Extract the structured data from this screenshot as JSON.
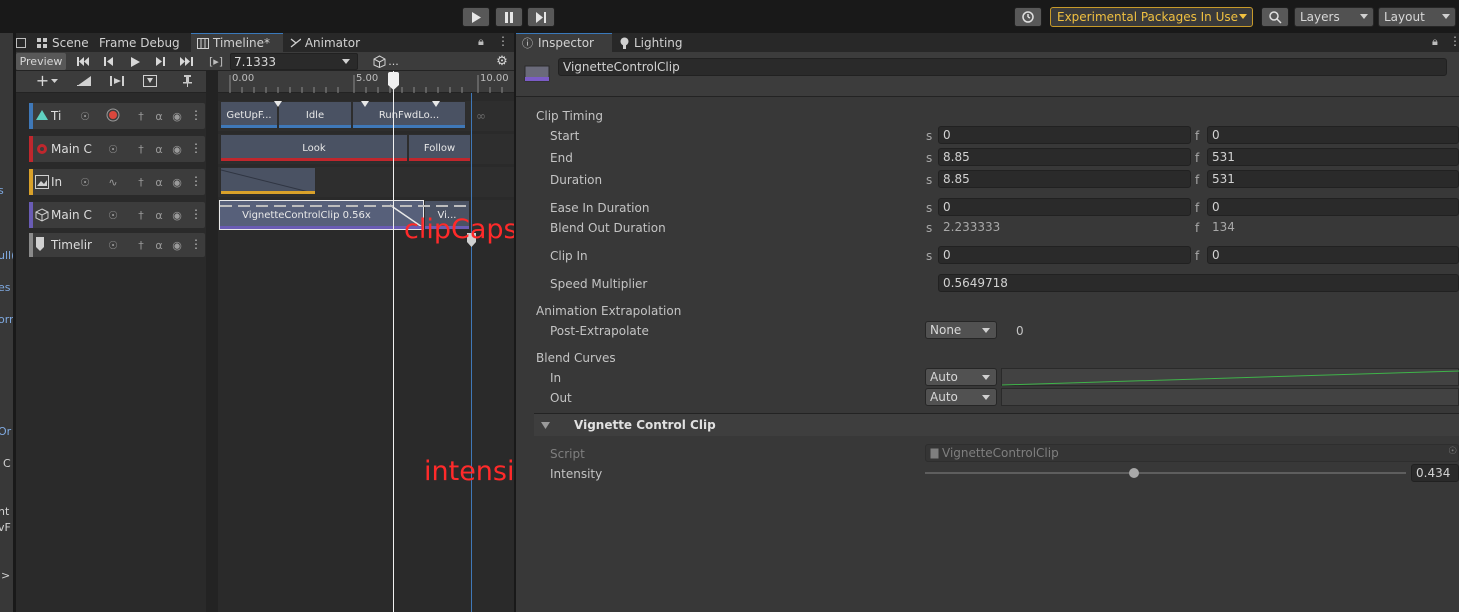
{
  "toolbar": {
    "experimental_label": "Experimental Packages In Use",
    "layers_label": "Layers",
    "layout_label": "Layout"
  },
  "left_sliver": [
    "s",
    "ull(",
    "es",
    "orr",
    "Or",
    "C",
    "nt",
    "vF",
    ">"
  ],
  "timeline_tabs": [
    {
      "label": "Scene"
    },
    {
      "label": "Frame Debug"
    },
    {
      "label": "Timeline*"
    },
    {
      "label": "Animator"
    }
  ],
  "timeline_controls": {
    "preview_label": "Preview",
    "time_value": "7.1333",
    "frame_bracket": "[▸]",
    "asset_dots": "..."
  },
  "ruler": {
    "ticks": [
      "0.00",
      "5.00",
      "10.00"
    ],
    "playhead_seconds": 7.1333
  },
  "tracks": [
    {
      "name": "Ti",
      "stripe": "#3f78b8",
      "icon": "activation-icon"
    },
    {
      "name": "Main C",
      "stripe": "#c0272d",
      "icon": "animator-icon"
    },
    {
      "name": "In",
      "stripe": "#d9a12a",
      "icon": "image-icon"
    },
    {
      "name": "Main C",
      "stripe": "#6a5cb5",
      "icon": "cube-icon"
    },
    {
      "name": "Timelir",
      "stripe": "#8a8a8a",
      "icon": "timeline-icon"
    }
  ],
  "clips": {
    "track1": [
      "GetUpF...",
      "Idle",
      "RunFwdLo..."
    ],
    "track2": [
      "Look",
      "Follow"
    ],
    "track4": [
      "VignetteControlClip 0.56x",
      "Vi..."
    ]
  },
  "inspector_tabs": [
    {
      "label": "Inspector"
    },
    {
      "label": "Lighting"
    }
  ],
  "inspector": {
    "object_name": "VignetteControlClip",
    "clip_timing_header": "Clip Timing",
    "rows": [
      {
        "label": "Start",
        "s": "0",
        "f": "0"
      },
      {
        "label": "End",
        "s": "8.85",
        "f": "531"
      },
      {
        "label": "Duration",
        "s": "8.85",
        "f": "531"
      },
      {
        "label": "Ease In Duration",
        "s": "0",
        "f": "0"
      },
      {
        "label": "Blend Out Duration",
        "s": "2.233333",
        "f": "134"
      },
      {
        "label": "Clip In",
        "s": "0",
        "f": "0"
      }
    ],
    "unit_s": "s",
    "unit_f": "f",
    "speed_multiplier_label": "Speed Multiplier",
    "speed_multiplier_value": "0.5649718",
    "extrapolation_header": "Animation Extrapolation",
    "post_extrapolate_label": "Post-Extrapolate",
    "post_extrapolate_value": "None",
    "post_extrapolate_extra": "0",
    "blend_curves_header": "Blend Curves",
    "in_label": "In",
    "in_value": "Auto",
    "out_label": "Out",
    "out_value": "Auto",
    "component_title": "Vignette Control Clip",
    "script_label": "Script",
    "script_value": "VignetteControlClip",
    "intensity_label": "Intensity",
    "intensity_value": "0.434",
    "intensity_fraction": 0.434
  },
  "annotations": {
    "clipcaps": "clipCaps",
    "intensity": "intensity"
  },
  "colors": {
    "accent_blue": "#3a79bb",
    "experimental_border": "#c79a2a",
    "experimental_text": "#f0c040",
    "annotation_red": "#ff2a2a",
    "curve_green": "#3fb34a"
  }
}
